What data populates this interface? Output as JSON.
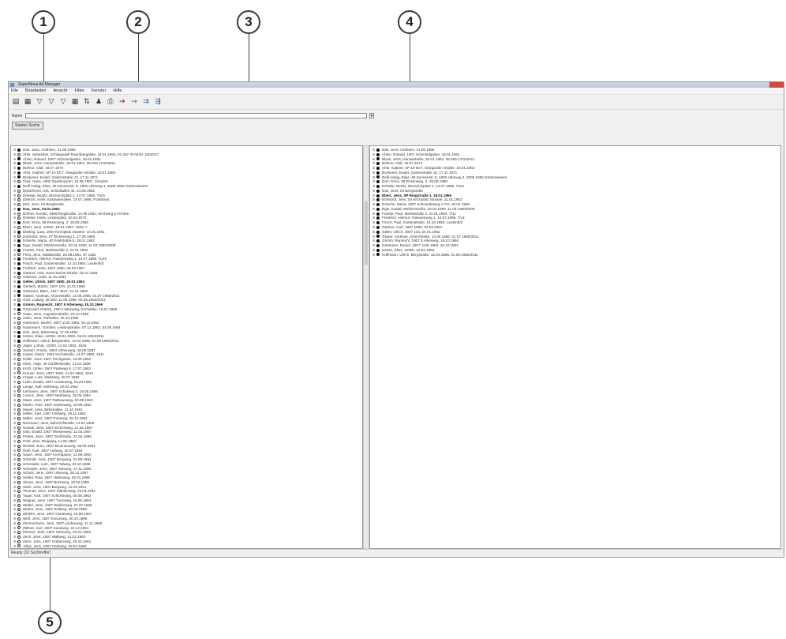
{
  "callouts": [
    "1",
    "2",
    "3",
    "4",
    "5"
  ],
  "window": {
    "title": "SuperNova Ad Manager",
    "menu": [
      "File",
      "Bearbeiten",
      "Ansicht",
      "Filter",
      "Fenster",
      "Hilfe"
    ],
    "name_label": "Name",
    "button_label": "Starten Suche",
    "status": "Ready (10 Suchtreffer)"
  },
  "toolbar_icons": [
    "open-icon",
    "save-icon",
    "filter-icon",
    "filter-add-icon",
    "filter-clear-icon",
    "table-icon",
    "sort-icon",
    "person-icon",
    "print-icon",
    "arrow-right-icon",
    "arrow-forward-icon",
    "merge-icon",
    "split-icon"
  ],
  "left_list": [
    {
      "m": "filled",
      "t": "Das, Janu, Andheim, 21.06.1965"
    },
    {
      "m": "open",
      "t": "Ähle, Sebastian, Schlagwaldt Raumbergallee, 24.01.1964, 01.407 IN 02/04 1502027"
    },
    {
      "m": "filled",
      "t": "Ahlen, Roland, 1907 Schmiedgasse, 18.01.1961"
    },
    {
      "m": "filled",
      "t": "Blank, Jens, Hansastraße, 20.01.1964, 05.029 1702/2511"
    },
    {
      "m": "filled",
      "t": "Bohme, Olaf, 18.07.1974"
    },
    {
      "m": "filled",
      "t": "Ahle, Gabriel, SP 10 ECT, Stargarden Straße, 18.01.1962"
    },
    {
      "m": "filled",
      "t": "Bockenel, Ewald, Gartenstraße 12, 17.11.1971"
    },
    {
      "m": "open",
      "t": "Clad, Hans, 4000 Saarbrücken, 15.06.1987, Schulstr."
    },
    {
      "m": "filled",
      "t": "Deill Hubig, Elias, 48 Sonnenstr. 8, 1902 Uferweg 4, 2006 1992 Gartenwiesen"
    },
    {
      "m": "open",
      "t": "Disselhorst, Grit, Schloßallee 44, 24.06.1962"
    },
    {
      "m": "open",
      "t": "Drieske, Moritz, Bismarckplatz 2, 14.07.1965, Turm"
    },
    {
      "m": "open",
      "t": "Dietrich, Anke, Kastanienallee, 14.07.1966, Forsthaus"
    },
    {
      "m": "open",
      "t": "Dirk, Jens, 04 Bergstraße"
    },
    {
      "m": "filled",
      "t": "Das, Jens, 04.01.1961"
    },
    {
      "m": "open",
      "t": "Dreher, Kerstin, 1968 Ringstraße, 14.09.1963, Kirchweg 6 Fichten"
    },
    {
      "m": "open",
      "t": "Drieske, Hans, Lindenplatz, 20.04.1972"
    },
    {
      "m": "filled",
      "t": "Dürr, Erica, 98 Rosenweg, 2, 26.05.1966"
    },
    {
      "m": "open",
      "t": "Ebert, Jens, 12000, 18.01.1967, Höhe 7"
    },
    {
      "m": "filled",
      "t": "Ebeling, Lara, 1904 Kirchplatz Strasse, 14.01.1961"
    },
    {
      "m": "open",
      "t": "Eckhardt, Jens, 07 Eichenweg 1, 17.09.1966"
    },
    {
      "m": "filled",
      "t": "Eckerlin, Maria, 40 Poststraße 5, 19.01.1962"
    },
    {
      "m": "filled",
      "t": "Eger, Ewald, Mühlenstraße, 20.04.1960, 11.03 1990/2008"
    },
    {
      "m": "filled",
      "t": "Franke, Paul, Marktstraße 3, 22.01.1964"
    },
    {
      "m": "open",
      "t": "Feist, Jens, Waldstraße, 23.08.1961, 07 1562"
    },
    {
      "m": "filled",
      "t": "Friedrich, Helmut, Fasanenweg 1, 14.07.1968, Turm"
    },
    {
      "m": "filled",
      "t": "Frisch, Paul, Gartenstraße, 14.10.1964, Lindenhof"
    },
    {
      "m": "filled",
      "t": "Fröhlich, Jens, 1907 1800, 03.03.1967"
    },
    {
      "m": "filled",
      "t": "Gärtner, Axel, Hans-Sachs-Straße, 01.01.1961"
    },
    {
      "m": "open",
      "t": "Gassner, Jutta, 11.01.1964"
    },
    {
      "m": "filled",
      "t": "Geller, Ulrich, 1907 1800, 20.01.1962"
    },
    {
      "m": "filled",
      "t": "Gerlach, Martin, 1907 104, 12.01.1968"
    },
    {
      "m": "filled",
      "t": "Giesecke, Björn, 1917 3647, 21.01.1962"
    },
    {
      "m": "filled",
      "t": "Glaser, Andreas, Ahornstraße, 14.06.1966, 01.07 1968/2011"
    },
    {
      "m": "open",
      "t": "Graf, Ludwig, 48 000, 11.08.1966, 05.06.1962/2012"
    },
    {
      "m": "filled",
      "t": "Grimm, Ruprecht, 1907 5 Altenweg, 15.10.1966"
    },
    {
      "m": "filled",
      "t": "Grünwald, Patrick, 1907 Hirtenweg, Kirchallee, 19.01.1965"
    },
    {
      "m": "open",
      "t": "Haas, Jens, Augustenstraße, 20.10.1962"
    },
    {
      "m": "open",
      "t": "Hahn, Jens, Parkallee, 18.10.1963"
    },
    {
      "m": "open",
      "t": "Hartmann, Daniel, 1907 1140 1963, 16.12.1962"
    },
    {
      "m": "open",
      "t": "Hausmann, Günther, Lessingstraße, 07.12.1962, 04.06.1964"
    },
    {
      "m": "filled",
      "t": "Heil, Jens, Birkenweg, 17.09.1964"
    },
    {
      "m": "filled",
      "t": "Hesse, Elias, 12000, 18.01.1962, 04.01.1964/2011"
    },
    {
      "m": "filled",
      "t": "Hoffmann, Ulrich, Bergstraße, 12.04.1966, 01.09.1962/2011"
    },
    {
      "m": "open",
      "t": "Jäger, Lothar, 12000, 12.04.1963, 1925"
    },
    {
      "m": "open",
      "t": "Jansen, Frieda, 1904 Ulmenweg, 18.09.1967"
    },
    {
      "m": "open",
      "t": "Kaiser, Dieter, 1904 Kirchstraße, 14.07.1960, 1911"
    },
    {
      "m": "open",
      "t": "Keller, Jens, 1907 Kirchgasse, 10.09.1963"
    },
    {
      "m": "open",
      "t": "Klein, Antje, 48 Schillerstraße, 14.02.1968"
    },
    {
      "m": "open",
      "t": "Koch, Ulrike, 1907 Parkweg 9, 17.07.1962"
    },
    {
      "m": "open",
      "t": "Krause, Jens, 1907 1800, 11.04.1962, 1913"
    },
    {
      "m": "open",
      "t": "Krüger, Lutz, Waldweg, 20.07.1962"
    },
    {
      "m": "open",
      "t": "Kuhn, Ewald, 1907 Lindenweg, 15.04.1961"
    },
    {
      "m": "open",
      "t": "Lange, Ralf, Mühlweg, 22.04.1964"
    },
    {
      "m": "open",
      "t": "Lehmann, Jens, 1907 Schulweg 3, 18.05.1966"
    },
    {
      "m": "open",
      "t": "Lorenz, Jens, 1907 Marktweg, 25.06.1964"
    },
    {
      "m": "open",
      "t": "Maier, Jens, 1907 Rathausweg, 03.08.1963"
    },
    {
      "m": "open",
      "t": "Martin, Paul, 1907 Gartenweg, 16.09.1962"
    },
    {
      "m": "open",
      "t": "Meyer, Jens, Birkenallee, 12.10.1961"
    },
    {
      "m": "open",
      "t": "Möller, Karl, 1907 Feldweg, 09.11.1962"
    },
    {
      "m": "open",
      "t": "Müller, Jens, 1907 Postweg, 28.12.1964"
    },
    {
      "m": "open",
      "t": "Neumann, Jens, Bahnhofstraße, 14.01.1965"
    },
    {
      "m": "open",
      "t": "Nowak, Jens, 1907 Eichenweg, 21.02.1967"
    },
    {
      "m": "open",
      "t": "Otto, Ewald, 1907 Wiesenweg, 11.03.1967"
    },
    {
      "m": "open",
      "t": "Peters, Jens, 1907 Dorfstraße, 22.04.1968"
    },
    {
      "m": "open",
      "t": "Pohl, Jens, Ringweg, 14.05.1962"
    },
    {
      "m": "open",
      "t": "Richter, Jens, 1907 Brunnenweg, 06.06.1961"
    },
    {
      "m": "open",
      "t": "Roth, Karl, 1907 Hofweg, 30.07.1962"
    },
    {
      "m": "open",
      "t": "Sauer, Jens, 1907 Kirchgasse, 12.08.1963"
    },
    {
      "m": "open",
      "t": "Schmidt, Jens, 1907 Bergweg, 24.09.1964"
    },
    {
      "m": "open",
      "t": "Schneider, Lutz, 1907 Talweg, 03.10.1965"
    },
    {
      "m": "open",
      "t": "Schröder, Jens, 1907 Seeweg, 17.11.1966"
    },
    {
      "m": "open",
      "t": "Schulz, Jens, 1907 Uferweg, 28.12.1967"
    },
    {
      "m": "open",
      "t": "Seidel, Paul, 1907 Hafenweg, 09.01.1968"
    },
    {
      "m": "open",
      "t": "Simon, Jens, 1907 Bachweg, 19.02.1969"
    },
    {
      "m": "open",
      "t": "Stein, Jens, 1907 Burgweg, 12.03.1961"
    },
    {
      "m": "open",
      "t": "Thomas, Jens, 1907 Mühlenweg, 23.04.1962"
    },
    {
      "m": "open",
      "t": "Vogel, Karl, 1907 Schlossweg, 05.05.1963"
    },
    {
      "m": "open",
      "t": "Wagner, Jens, 1907 Turmweg, 16.06.1964"
    },
    {
      "m": "open",
      "t": "Walter, Jens, 1907 Weiherweg, 27.07.1965"
    },
    {
      "m": "open",
      "t": "Weber, Jens, 1907 Zollweg, 08.08.1966"
    },
    {
      "m": "open",
      "t": "Winkler, Jens, 1907 Heideweg, 19.09.1967"
    },
    {
      "m": "open",
      "t": "Wolf, Jens, 1907 Kreuzweg, 30.10.1968"
    },
    {
      "m": "open",
      "t": "Zimmermann, Jens, 1907 Lindenweg, 11.11.1969"
    },
    {
      "m": "open",
      "t": "Zöllner, Karl, 1907 Sandweg, 22.12.1961"
    },
    {
      "m": "open",
      "t": "Zimmer, Jens, 1907 Steinweg, 03.01.1962"
    },
    {
      "m": "open",
      "t": "Zech, Jens, 1907 Wallweg, 14.02.1963"
    },
    {
      "m": "open",
      "t": "Zahn, Jens, 1907 Grabenweg, 25.03.1964"
    },
    {
      "m": "open",
      "t": "Yildiz, Jens, 1907 Parkweg, 06.04.1965"
    },
    {
      "m": "open",
      "t": "Wendt, Jens, 1907 Teichweg, 17.05.1966"
    }
  ],
  "right_list": [
    {
      "m": "filled",
      "t": "Das, Jens, Andheim, 21.06.1965"
    },
    {
      "m": "filled",
      "t": "Ahlen, Roland, 1907 Schmiedgasse, 18.01.1961"
    },
    {
      "m": "filled",
      "t": "Blank, Jens, Hansastraße, 20.01.1964, 05.029 1702/2511"
    },
    {
      "m": "filled",
      "t": "Bohme, Olaf, 18.07.1974"
    },
    {
      "m": "filled",
      "t": "Ahle, Gabriel, SP 10 ECT, Stargarden Straße, 18.01.1962"
    },
    {
      "m": "filled",
      "t": "Bockenel, Ewald, Gartenstraße 12, 17.11.1971"
    },
    {
      "m": "filled",
      "t": "Deill Hubig, Elias, 48 Sonnenstr. 8, 1902 Uferweg 4, 2006 1992 Gartenwiesen"
    },
    {
      "m": "filled",
      "t": "Dürr, Erica, 98 Rosenweg, 2, 26.05.1966"
    },
    {
      "m": "filled",
      "t": "Drieske, Moritz, Bismarckplatz 2, 14.07.1965, Turm"
    },
    {
      "m": "filled",
      "t": "Das, Jens, 04 Bergstraße"
    },
    {
      "m": "filled",
      "t": "Ebert, Jens, SP Ringstraße 1, 18.01.1965"
    },
    {
      "m": "filled",
      "t": "Eckhardt, Jens, 04 Kirchplatz Strasse, 11.01.1963"
    },
    {
      "m": "filled",
      "t": "Eckerlin, Maria, 1907 Schmiedeweg 4 GO, 20.01.1966"
    },
    {
      "m": "filled",
      "t": "Eger, Ewald, Mühlenstraße, 20.04.1960, 11.03 1990/2008"
    },
    {
      "m": "filled",
      "t": "Franke, Paul, Marktstraße 3, 22.01.1964, 7/11"
    },
    {
      "m": "filled",
      "t": "Friedrich, Helmut, Fasanenweg 1, 14.07.1968, 7/14"
    },
    {
      "m": "filled",
      "t": "Frisch, Paul, Gartenstraße, 14.10.1964, Lindenhof"
    },
    {
      "m": "filled",
      "t": "Gärtner, Axel, 1907 1800, 03.03.1967"
    },
    {
      "m": "filled",
      "t": "Geller, Ulrich, 1907 104, 20.01.1962"
    },
    {
      "m": "filled",
      "t": "Glaser, Andreas, Ahornstraße, 14.06.1966, 01.07 1968/2011"
    },
    {
      "m": "filled",
      "t": "Grimm, Ruprecht, 1907 5 Altenweg, 15.10.1966"
    },
    {
      "m": "filled",
      "t": "Hartmann, Daniel, 1907 1140 1963, 16.12.1962"
    },
    {
      "m": "filled",
      "t": "Hesse, Elias, 12000, 18.01.1962"
    },
    {
      "m": "filled",
      "t": "Hoffmann, Ulrich, Bergstraße, 12.04.1966, 01.09.1962/2011"
    }
  ]
}
